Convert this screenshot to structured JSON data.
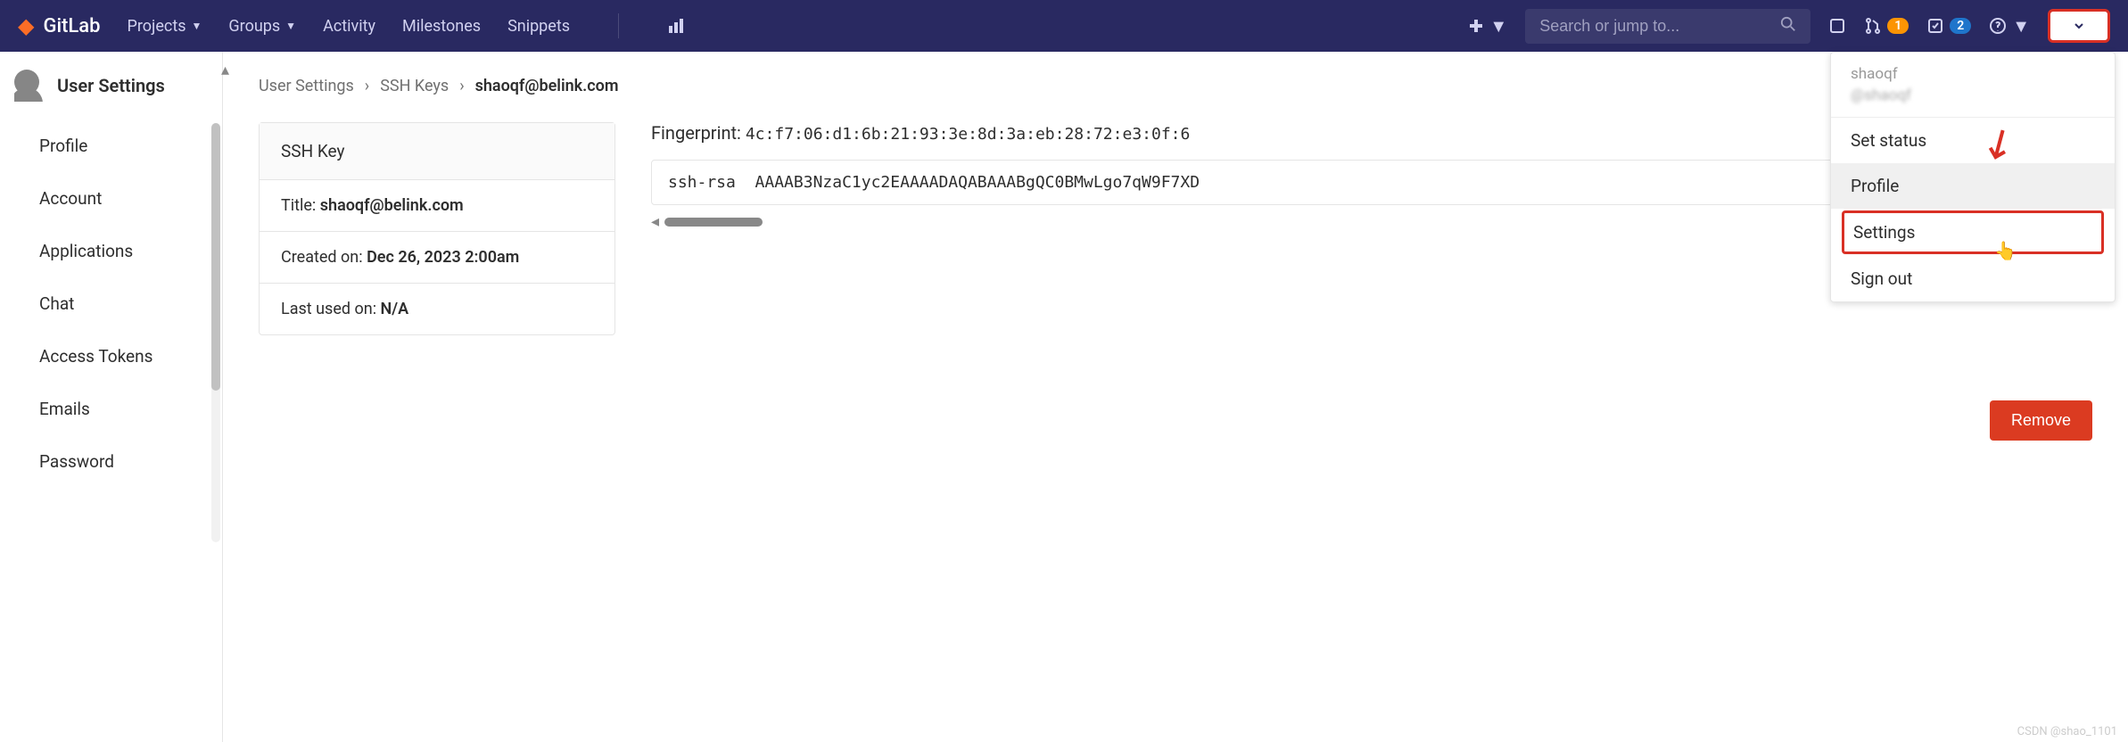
{
  "brand": "GitLab",
  "nav": {
    "projects": "Projects",
    "groups": "Groups",
    "activity": "Activity",
    "milestones": "Milestones",
    "snippets": "Snippets"
  },
  "search": {
    "placeholder": "Search or jump to..."
  },
  "badges": {
    "merge": "1",
    "todo": "2"
  },
  "sidebar": {
    "title": "User Settings",
    "items": [
      "Profile",
      "Account",
      "Applications",
      "Chat",
      "Access Tokens",
      "Emails",
      "Password"
    ]
  },
  "breadcrumb": {
    "level1": "User Settings",
    "level2": "SSH Keys",
    "level3": "shaoqf@belink.com"
  },
  "ssh": {
    "header": "SSH Key",
    "title_label": "Title: ",
    "title_value": "shaoqf@belink.com",
    "created_label": "Created on: ",
    "created_value": "Dec 26, 2023 2:00am",
    "lastused_label": "Last used on: ",
    "lastused_value": "N/A",
    "fingerprint_label": "Fingerprint: ",
    "fingerprint_value": "4c:f7:06:d1:6b:21:93:3e:8d:3a:eb:28:72:e3:0f:6",
    "key_type": "ssh-rsa",
    "key_content": "AAAAB3NzaC1yc2EAAAADAQABAAABgQC0BMwLgo7qW9F7XD"
  },
  "remove_label": "Remove",
  "dropdown": {
    "username": "shaoqf",
    "handle": "@shaoqf",
    "set_status": "Set status",
    "profile": "Profile",
    "settings": "Settings",
    "sign_out": "Sign out"
  },
  "watermark": "CSDN @shao_1101"
}
